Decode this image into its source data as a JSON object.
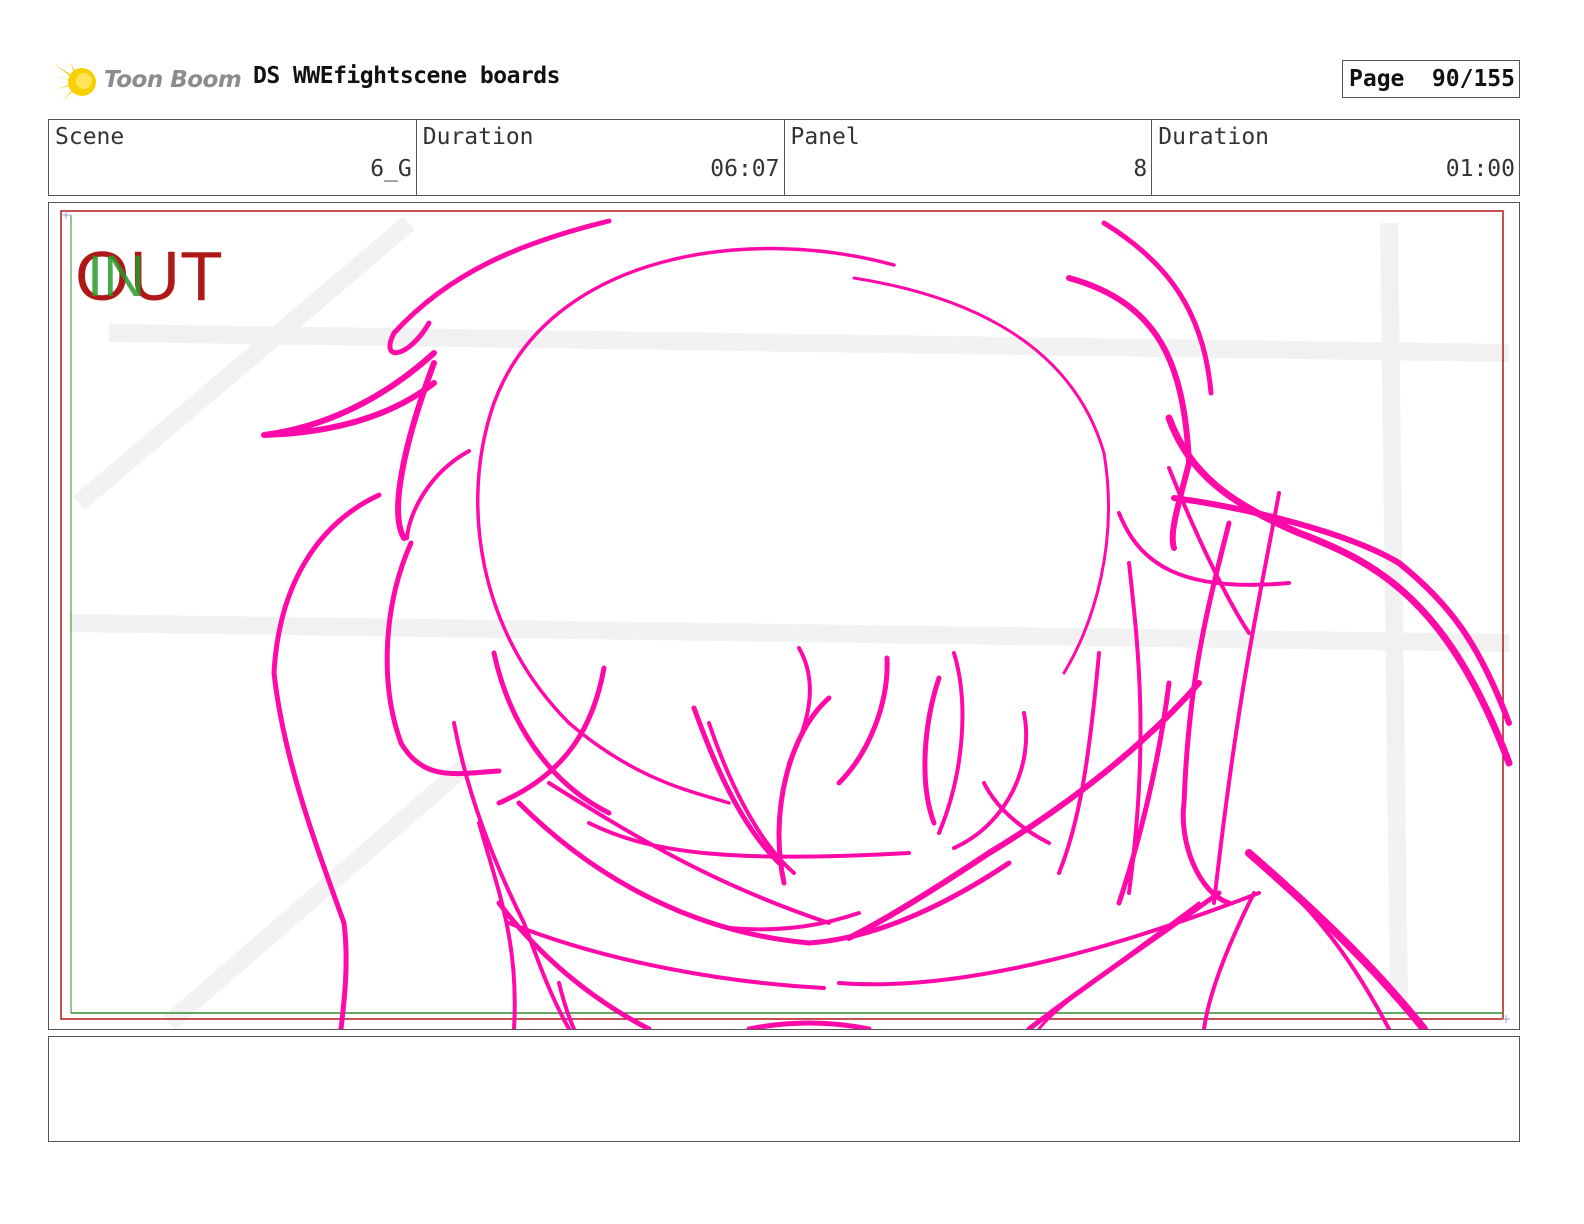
{
  "header": {
    "brand": "Toon Boom",
    "title": "DS WWEfightscene boards",
    "page_label": "Page",
    "page_value": "90/155"
  },
  "info": {
    "scene_label": "Scene",
    "scene_value": "6_G",
    "scene_duration_label": "Duration",
    "scene_duration_value": "06:07",
    "panel_label": "Panel",
    "panel_value": "8",
    "panel_duration_label": "Duration",
    "panel_duration_value": "01:00"
  },
  "panel": {
    "in_marker": "IN",
    "out_marker": "OUT",
    "sketch_color": "#ff0aa8",
    "safe_frame_color": "#b01818",
    "title_safe_color": "#2e8a2e"
  },
  "notes": {
    "text": ""
  }
}
